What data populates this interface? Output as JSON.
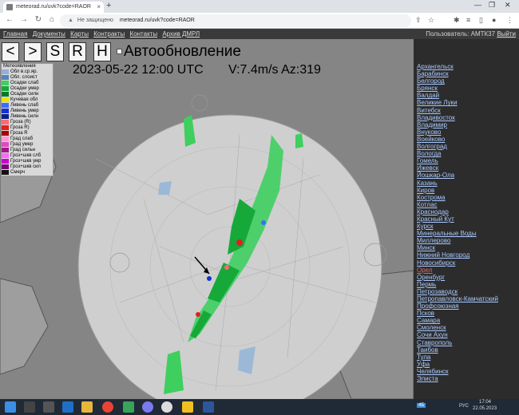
{
  "browser": {
    "tab_title": "meteorad.ru/uvk?code=RAOR",
    "tab_close": "×",
    "new_tab": "+",
    "security_label": "Не защищено",
    "url": "meteorad.ru/uvk?code=RAOR",
    "win_minimize": "—",
    "win_maximize": "❐",
    "win_close": "✕"
  },
  "site": {
    "menu": [
      "Главная",
      "Документы",
      "Карты",
      "Контракты",
      "Контакты",
      "Архив ДМРЛ"
    ],
    "user_label": "Пользователь: АМТК37",
    "logout": "Выйти"
  },
  "controls": {
    "prev": "<",
    "next": ">",
    "s": "S",
    "r": "R",
    "h": "H",
    "auto_update": "Автообновление"
  },
  "radar": {
    "timestamp": "2023-05-22 12:00 UTC",
    "velocity_info": "V:7.4m/s Az:319"
  },
  "legend": {
    "title": "Метеоявления",
    "items": [
      {
        "label": "Обл в.ср.яр.",
        "color": "#8fb1d8"
      },
      {
        "label": "Обл. слоист",
        "color": "#5a82b8"
      },
      {
        "label": "Осадки слаб",
        "color": "#3ecf5f"
      },
      {
        "label": "Осадки умер",
        "color": "#16a93a"
      },
      {
        "label": "Осадки силн",
        "color": "#0a7a24"
      },
      {
        "label": "Кучевая обл",
        "color": "#e6e600"
      },
      {
        "label": "Ливень слаб",
        "color": "#3b6dff"
      },
      {
        "label": "Ливень умер",
        "color": "#1033d6"
      },
      {
        "label": "Ливень силн",
        "color": "#071f8a"
      },
      {
        "label": "Гроза (R)",
        "color": "#ff6a6a"
      },
      {
        "label": "Гроза R)",
        "color": "#e02020"
      },
      {
        "label": "Гроза R",
        "color": "#a80000"
      },
      {
        "label": "Град слаб",
        "color": "#ff9ad6"
      },
      {
        "label": "Град умер",
        "color": "#e04cbc"
      },
      {
        "label": "Град сильн",
        "color": "#a01a88"
      },
      {
        "label": "Гроз+шкв слб",
        "color": "#ff66ff"
      },
      {
        "label": "Гроз+шкв умр",
        "color": "#cc00cc"
      },
      {
        "label": "Гроз+шкв сил",
        "color": "#770077"
      },
      {
        "label": "Смерч",
        "color": "#111111"
      }
    ]
  },
  "cities": [
    "Архангельск",
    "Барабинск",
    "Белгород",
    "Брянск",
    "Валдай",
    "Великие Луки",
    "Витебск",
    "Владивосток",
    "Владимир",
    "Внуково",
    "Воейково",
    "Волгоград",
    "Вологда",
    "Гомель",
    "Ижевск",
    "Йошкар-Ола",
    "Казань",
    "Киров",
    "Кострома",
    "Котлас",
    "Краснодар",
    "Красный Кут",
    "Курск",
    "Минеральные Воды",
    "Миллерово",
    "Минск",
    "Нижний Новгород",
    "Новосибирск",
    "Орел",
    "Оренбург",
    "Пермь",
    "Петрозаводск",
    "Петропавловск-Камчатский",
    "Профсоюзная",
    "Псков",
    "Самара",
    "Смоленск",
    "Сочи Ахун",
    "Ставрополь",
    "Таибов",
    "Тула",
    "Уфа",
    "Челябинск",
    "Элиста"
  ],
  "active_city": "Орел",
  "taskbar": {
    "weather_temp": "4Б",
    "lang": "РУС",
    "time": "17:04",
    "date": "22.05.2023"
  }
}
